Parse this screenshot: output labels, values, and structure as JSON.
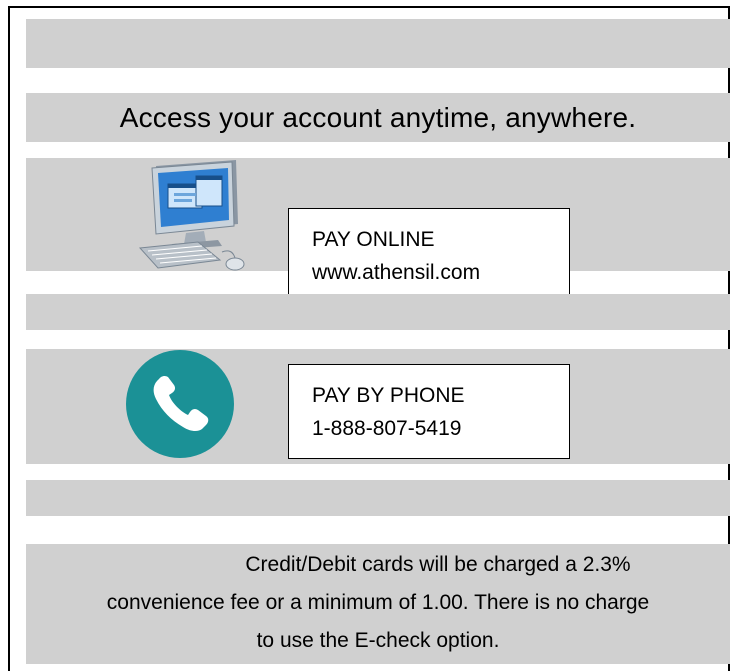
{
  "headline": "Access your account anytime, anywhere.",
  "online": {
    "label": "PAY ONLINE",
    "url": "www.athensil.com",
    "icon": "computer-icon"
  },
  "phone": {
    "label": "PAY BY PHONE",
    "number": "1-888-807-5419",
    "icon": "phone-icon"
  },
  "note": {
    "line1": "Credit/Debit cards will be charged a 2.3%",
    "line2": "convenience fee or a minimum of 1.00. There is no charge",
    "line3": "to use the E-check option."
  },
  "colors": {
    "band": "#d0d0d0",
    "phone_circle": "#1b9196"
  }
}
